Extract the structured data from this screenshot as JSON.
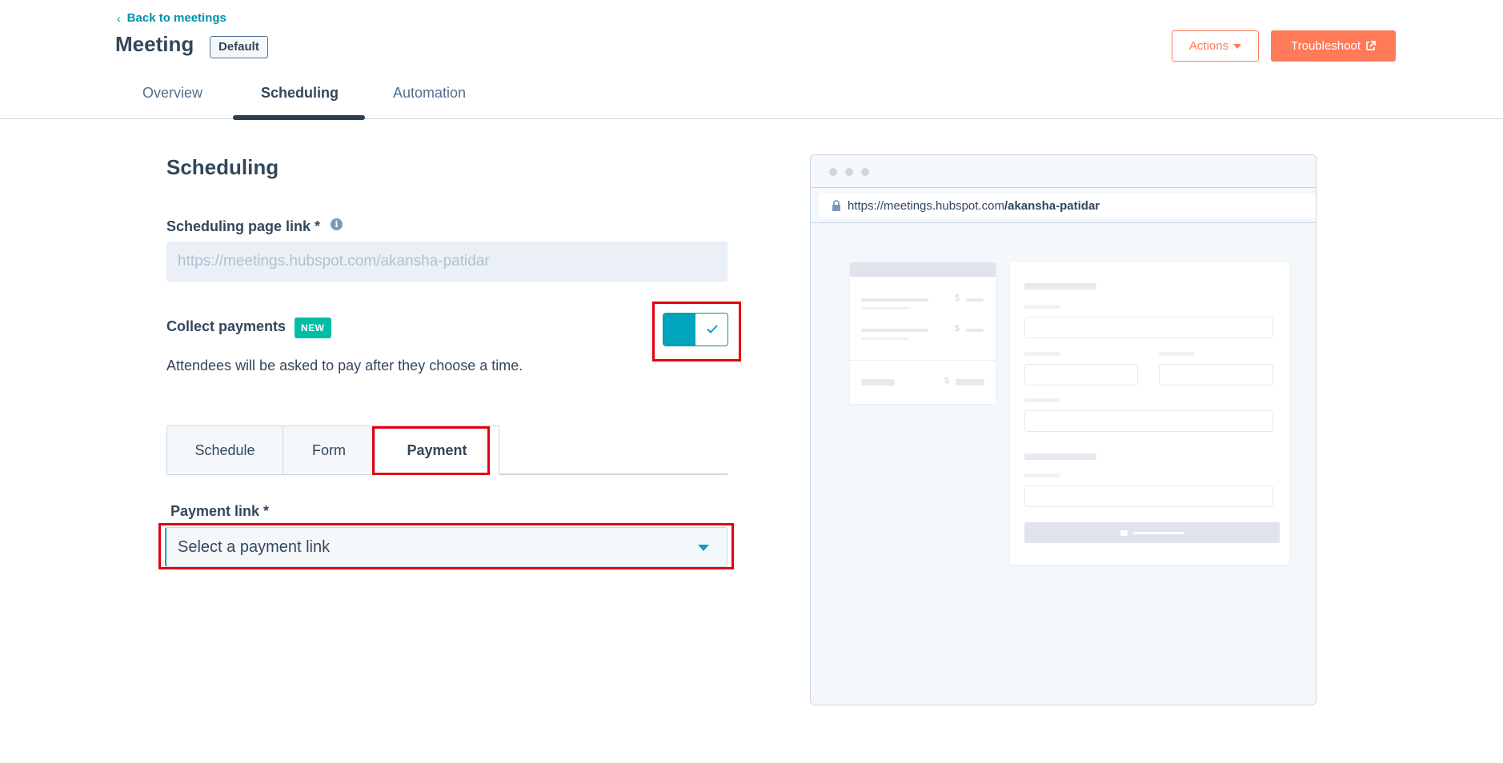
{
  "header": {
    "back_label": "Back to meetings",
    "title": "Meeting",
    "badge": "Default",
    "actions_label": "Actions",
    "troubleshoot_label": "Troubleshoot"
  },
  "tabs": [
    {
      "label": "Overview",
      "active": false
    },
    {
      "label": "Scheduling",
      "active": true
    },
    {
      "label": "Automation",
      "active": false
    }
  ],
  "scheduling": {
    "title": "Scheduling",
    "page_link_label": "Scheduling page link *",
    "page_link_placeholder": "https://meetings.hubspot.com/akansha-patidar",
    "collect_payments_label": "Collect payments",
    "new_badge": "NEW",
    "collect_payments_enabled": true,
    "collect_payments_desc": "Attendees will be asked to pay after they choose a time.",
    "subtabs": [
      {
        "label": "Schedule",
        "active": false
      },
      {
        "label": "Form",
        "active": false
      },
      {
        "label": "Payment",
        "active": true
      }
    ],
    "payment_link_label": "Payment link *",
    "payment_link_placeholder": "Select a payment link"
  },
  "preview": {
    "url_prefix": "https://meetings.hubspot.com",
    "url_path": "/akansha-patidar"
  },
  "colors": {
    "accent": "#00a4bd",
    "link": "#0091ae",
    "orange": "#ff7a59",
    "highlight": "#e4000f",
    "text": "#33475b"
  }
}
